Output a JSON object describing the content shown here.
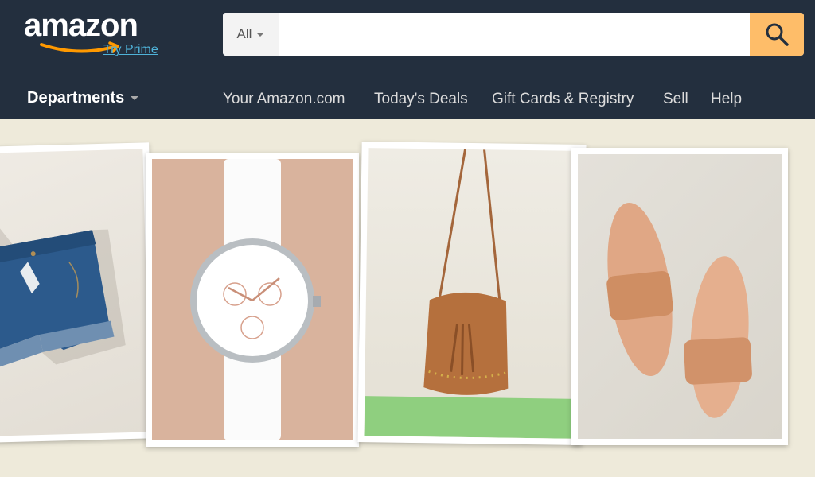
{
  "logo": {
    "wordmark": "amazon",
    "tagline": "Try Prime"
  },
  "search": {
    "category": "All",
    "placeholder": "",
    "button_icon": "search-icon"
  },
  "nav": {
    "departments": "Departments",
    "links": [
      "Your Amazon.com",
      "Today's Deals",
      "Gift Cards & Registry",
      "Sell",
      "Help"
    ]
  },
  "colors": {
    "header_bg": "#232f3e",
    "search_button": "#febd69",
    "page_bg": "#eeeada",
    "prime_link": "#4fb3d9"
  },
  "products": [
    {
      "name": "denim-shorts"
    },
    {
      "name": "watch"
    },
    {
      "name": "suede-bucket-bag"
    },
    {
      "name": "rose-gold-slides"
    }
  ]
}
